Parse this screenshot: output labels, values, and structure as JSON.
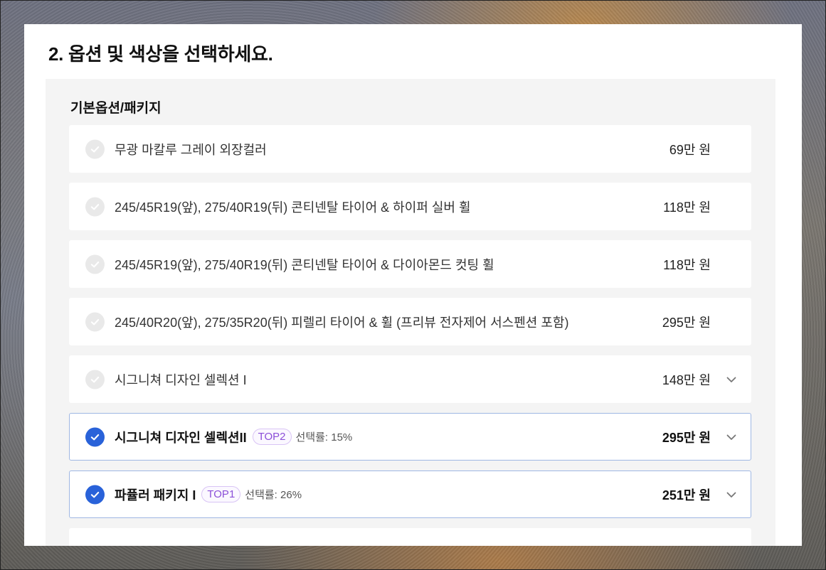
{
  "section": {
    "title": "2. 옵션 및 색상을 선택하세요."
  },
  "group": {
    "title": "기본옵션/패키지"
  },
  "options": [
    {
      "label": "무광 마칼루 그레이 외장컬러",
      "price": "69만 원",
      "selected": false,
      "expandable": false
    },
    {
      "label": "245/45R19(앞), 275/40R19(뒤) 콘티넨탈 타이어 & 하이퍼 실버 휠",
      "price": "118만 원",
      "selected": false,
      "expandable": false
    },
    {
      "label": "245/45R19(앞), 275/40R19(뒤) 콘티넨탈 타이어 & 다이아몬드 컷팅 휠",
      "price": "118만 원",
      "selected": false,
      "expandable": false
    },
    {
      "label": "245/40R20(앞), 275/35R20(뒤) 피렐리 타이어 & 휠 (프리뷰 전자제어 서스펜션 포함)",
      "price": "295만 원",
      "selected": false,
      "expandable": false
    },
    {
      "label": "시그니쳐 디자인 셀렉션 I",
      "price": "148만 원",
      "selected": false,
      "expandable": true
    },
    {
      "label": "시그니쳐 디자인 셀렉션II",
      "price": "295만 원",
      "selected": true,
      "expandable": true,
      "badge": "TOP2",
      "rate": "선택률: 15%"
    },
    {
      "label": "파퓰러 패키지 I",
      "price": "251만 원",
      "selected": true,
      "expandable": true,
      "badge": "TOP1",
      "rate": "선택률: 26%"
    }
  ],
  "colors": {
    "accent": "#2962d9",
    "badge": "#8b4fd8",
    "selected_border": "#9fb7e3"
  },
  "icons": {
    "check": "check-icon",
    "expand": "chevron-down-icon"
  }
}
